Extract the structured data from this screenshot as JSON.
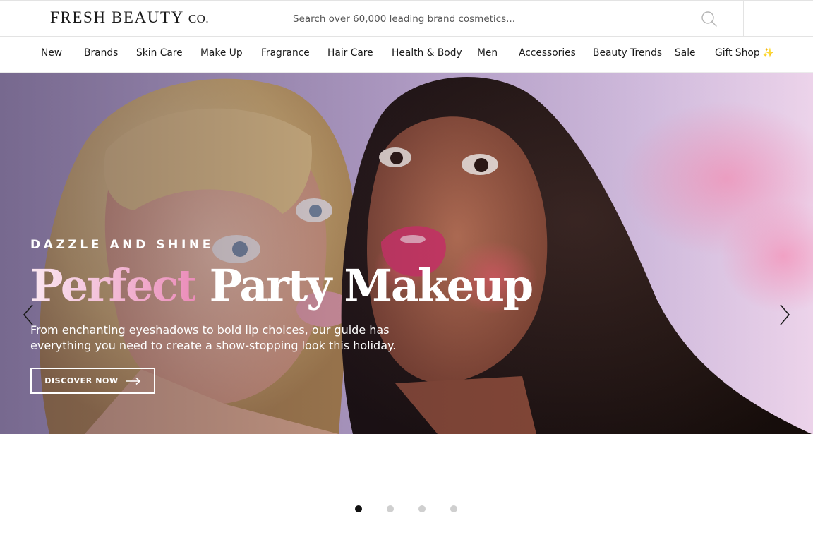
{
  "header": {
    "logo": {
      "main": "FRESH BEAUTY",
      "suffix": "CO."
    },
    "search": {
      "placeholder": "Search over 60,000 leading brand cosmetics..."
    }
  },
  "nav": {
    "items": [
      {
        "label": "New"
      },
      {
        "label": "Brands"
      },
      {
        "label": "Skin Care"
      },
      {
        "label": "Make Up"
      },
      {
        "label": "Fragrance"
      },
      {
        "label": "Hair Care"
      },
      {
        "label": "Health & Body"
      },
      {
        "label": "Men"
      },
      {
        "label": "Accessories"
      },
      {
        "label": "Beauty Trends"
      },
      {
        "label": "Sale"
      },
      {
        "label": "Gift Shop",
        "icon": "sparkles-icon"
      }
    ]
  },
  "hero": {
    "eyebrow": "DAZZLE AND SHINE",
    "headline": {
      "accent": "Perfect",
      "rest": " Party Makeup"
    },
    "subtitle": "From enchanting eyeshadows to bold lip choices, our guide has everything you need to create a show-stopping look this holiday.",
    "cta": {
      "label": "DISCOVER NOW",
      "icon": "arrow-right-icon"
    },
    "prev_icon": "chevron-left-icon",
    "next_icon": "chevron-right-icon",
    "accent_color": "#f0a9cb"
  },
  "carousel": {
    "slide_count": 4,
    "active_index": 0
  }
}
